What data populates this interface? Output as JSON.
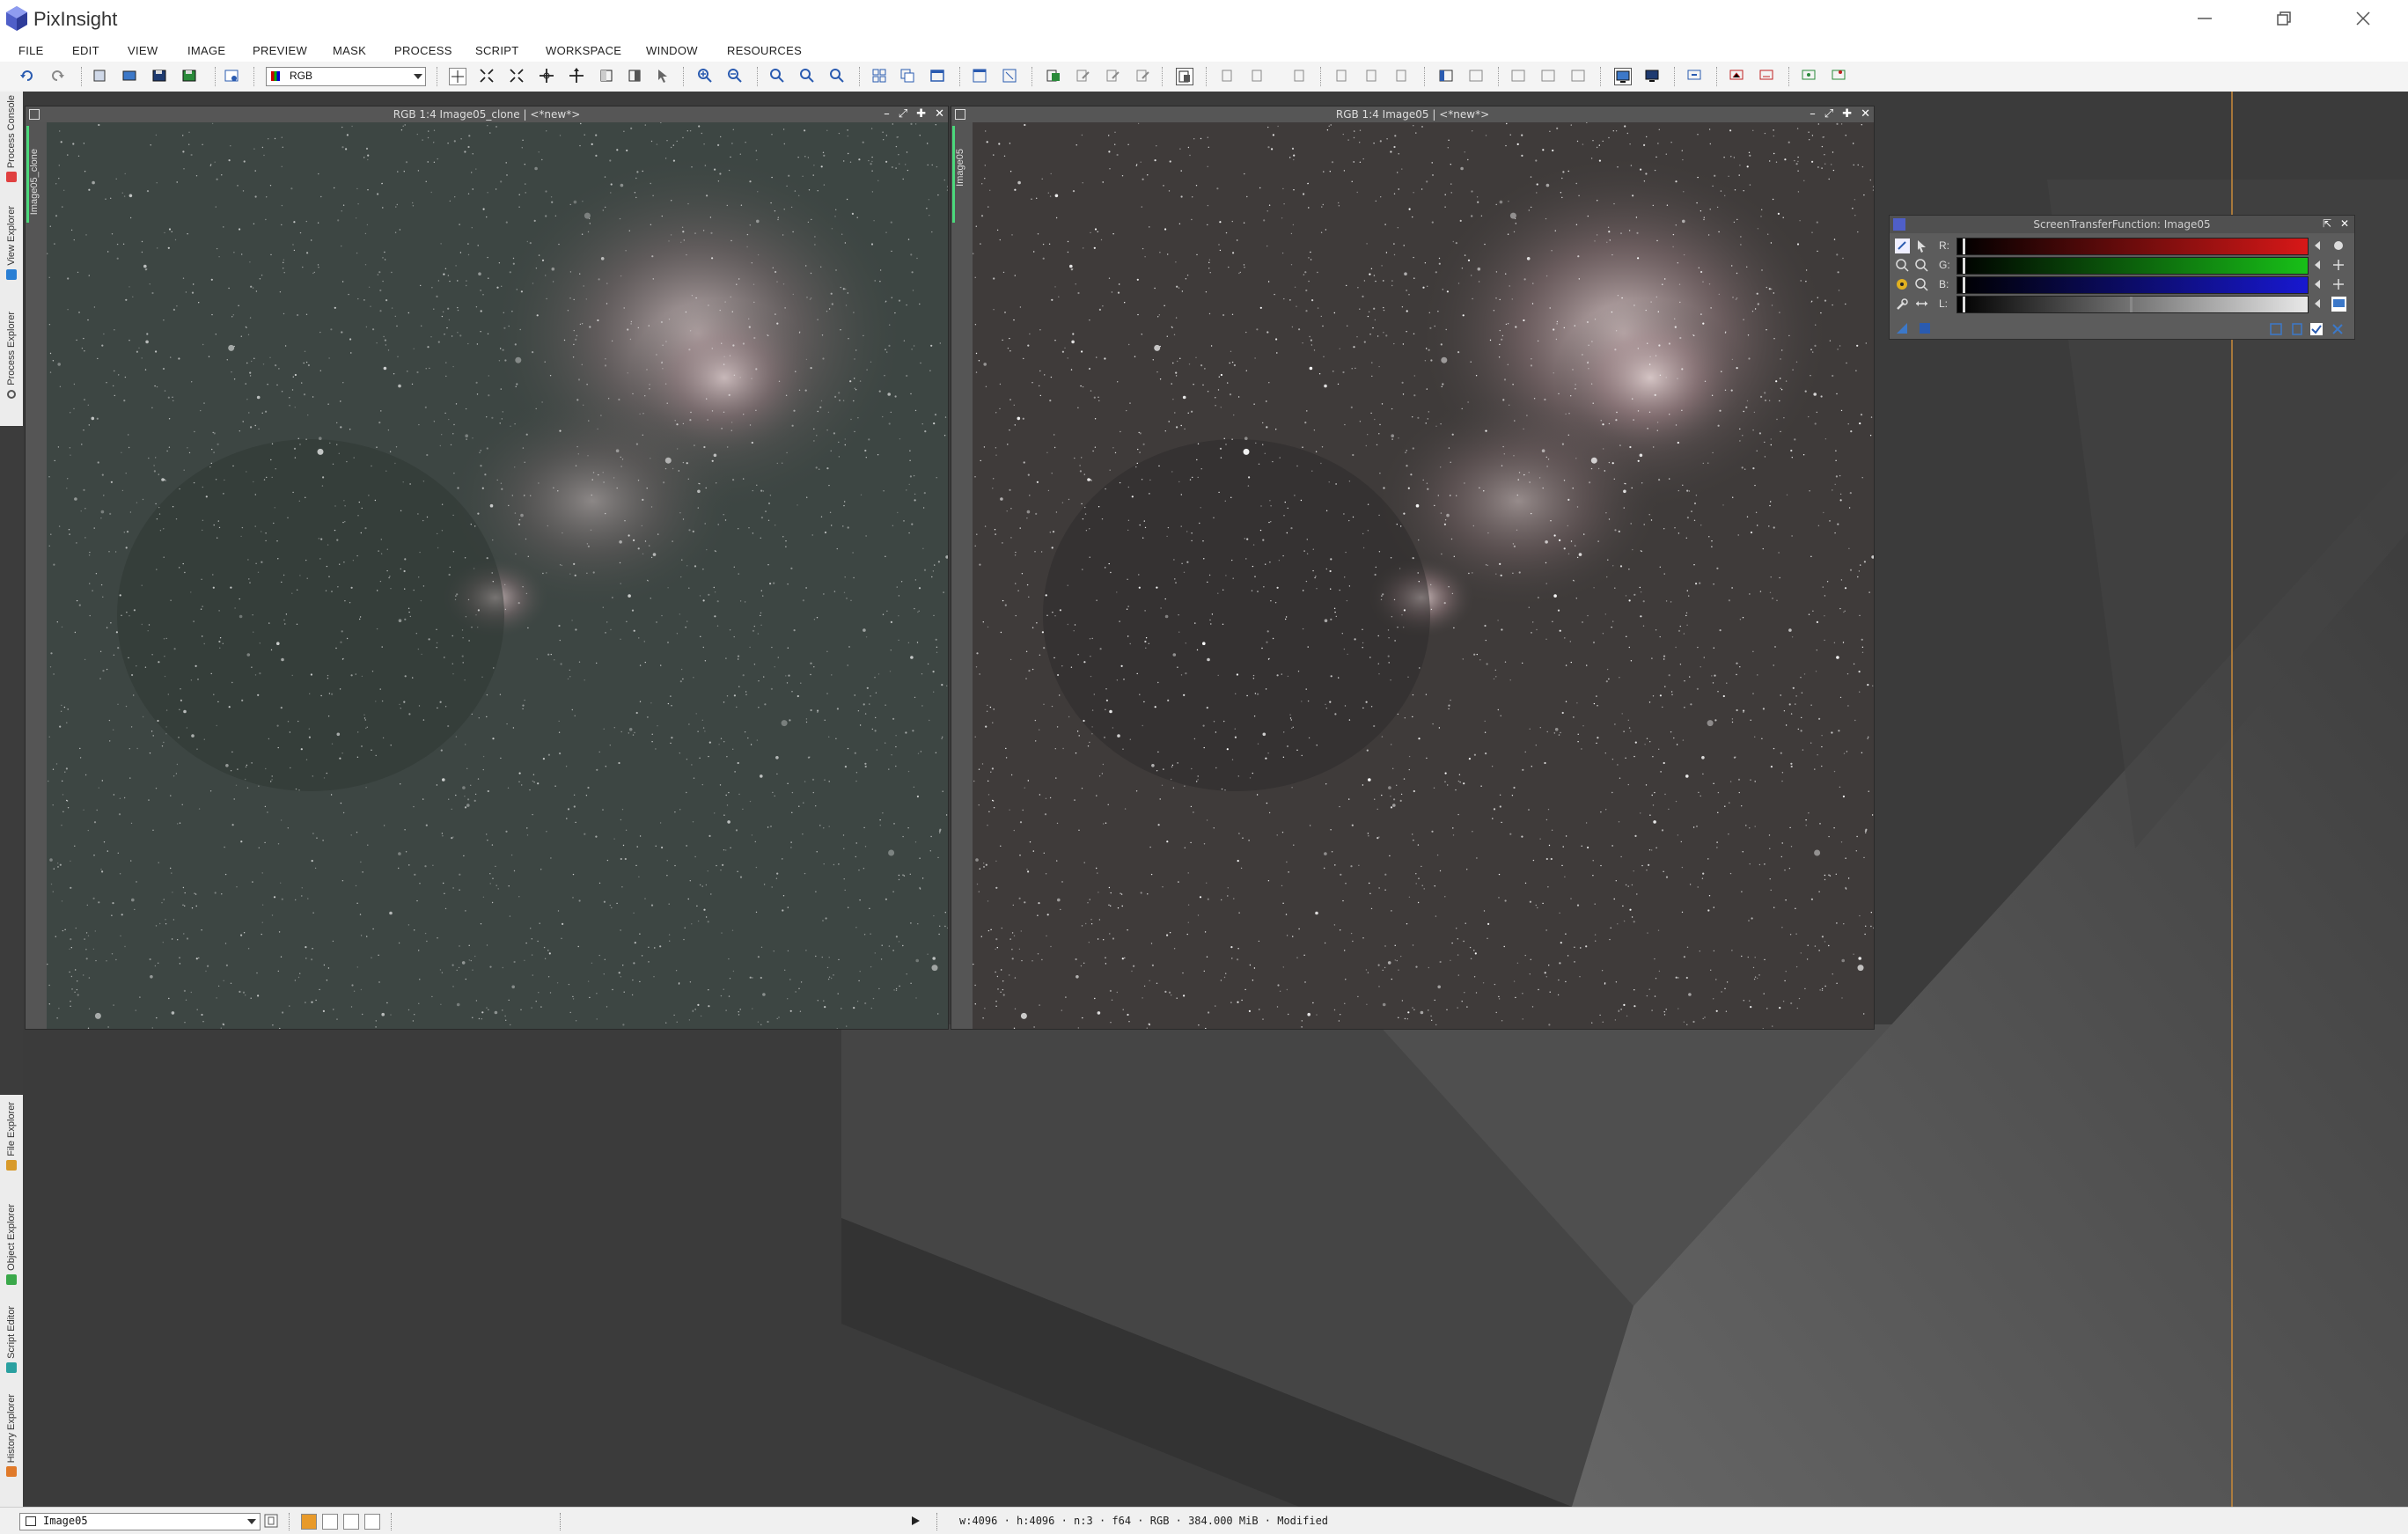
{
  "app": {
    "title": "PixInsight"
  },
  "menu": [
    "FILE",
    "EDIT",
    "VIEW",
    "IMAGE",
    "PREVIEW",
    "MASK",
    "PROCESS",
    "SCRIPT",
    "WORKSPACE",
    "WINDOW",
    "RESOURCES"
  ],
  "toolbar": {
    "color_space": "RGB"
  },
  "side_tabs_top": [
    {
      "label": "Process Console",
      "icon": "console-icon",
      "color": "#e04040"
    },
    {
      "label": "View Explorer",
      "icon": "view-explorer-icon",
      "color": "#2a7fd4"
    },
    {
      "label": "Process Explorer",
      "icon": "gear-icon",
      "color": "#555555"
    }
  ],
  "side_tabs_bottom": [
    {
      "label": "File Explorer",
      "icon": "folder-icon",
      "color": "#d89a2a"
    },
    {
      "label": "Object Explorer",
      "icon": "object-icon",
      "color": "#3aa84a"
    },
    {
      "label": "Script Editor",
      "icon": "script-icon",
      "color": "#2aa0a0"
    },
    {
      "label": "History Explorer",
      "icon": "history-icon",
      "color": "#e07a2a"
    }
  ],
  "windows": [
    {
      "title": "RGB 1:4 Image05_clone | <*new*>",
      "tab": "Image05_clone"
    },
    {
      "title": "RGB 1:4 Image05 | <*new*>",
      "tab": "Image05"
    }
  ],
  "stf": {
    "title": "ScreenTransferFunction: Image05",
    "channels": [
      {
        "label": "R:",
        "color": "#d81818"
      },
      {
        "label": "G:",
        "color": "#18c018"
      },
      {
        "label": "B:",
        "color": "#1818d0"
      },
      {
        "label": "L:",
        "color": "#e8e8e8"
      }
    ]
  },
  "status": {
    "view": "Image05",
    "info": "w:4096 · h:4096 · n:3 · f64 · RGB · 384.000 MiB · Modified"
  }
}
